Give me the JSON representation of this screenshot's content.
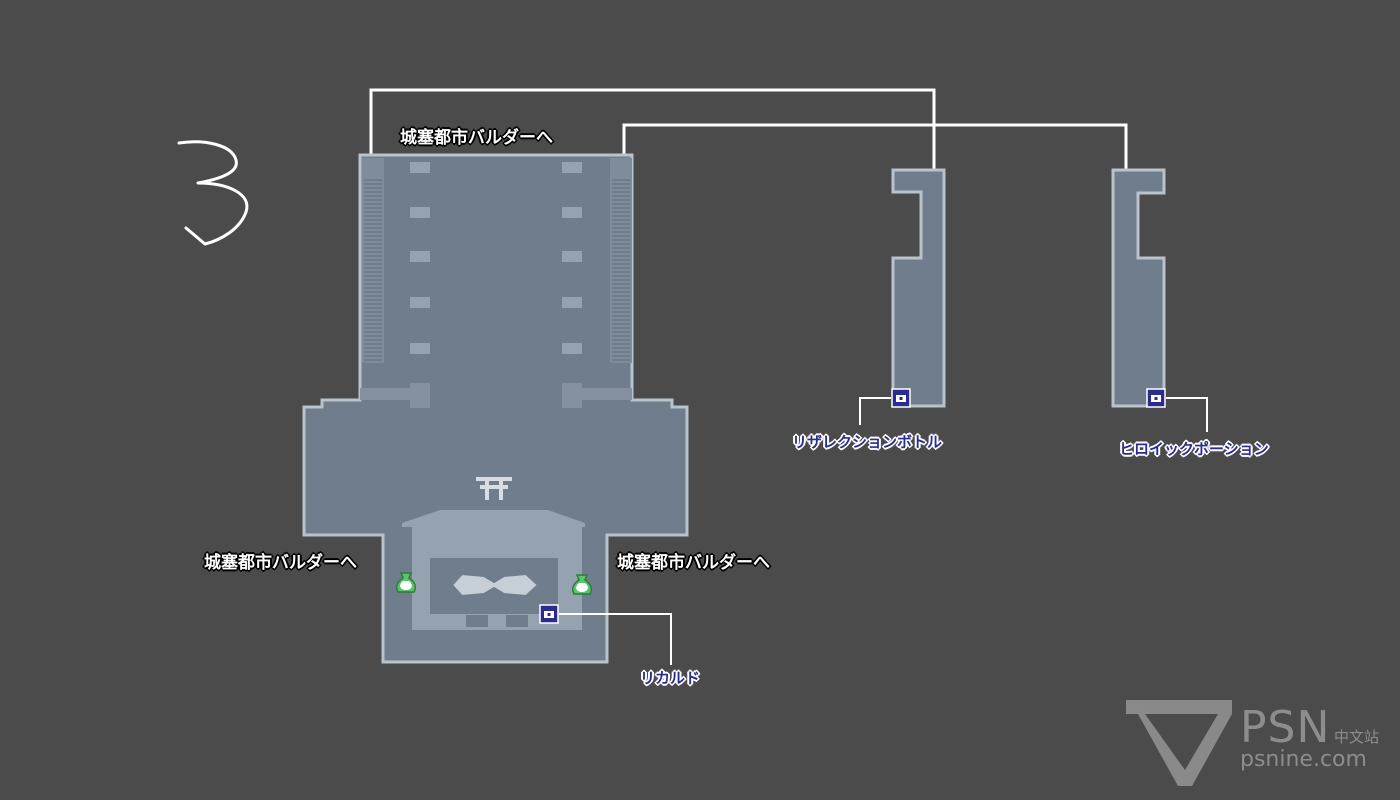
{
  "floor_number": "3",
  "exits": {
    "north": "城塞都市バルダーへ",
    "west": "城塞都市バルダーへ",
    "east": "城塞都市バルダーへ"
  },
  "items": {
    "chest_main": "リカルド",
    "chest_middle_room": "リザレクションボトル",
    "chest_right_room": "ヒロイックポーション"
  },
  "icons": [
    "treasure-chest-icon",
    "money-bag-icon",
    "stairs-icon",
    "torii-gate-icon"
  ],
  "colors": {
    "background": "#4b4b4b",
    "room_fill": "#6f7d8d",
    "room_border": "#b9c3cc",
    "label_item": "#2a2c90",
    "money_bag": "#59c46a"
  },
  "watermark": {
    "brand": "PSN",
    "brand_suffix": "中文站",
    "site": "psnine.com"
  }
}
